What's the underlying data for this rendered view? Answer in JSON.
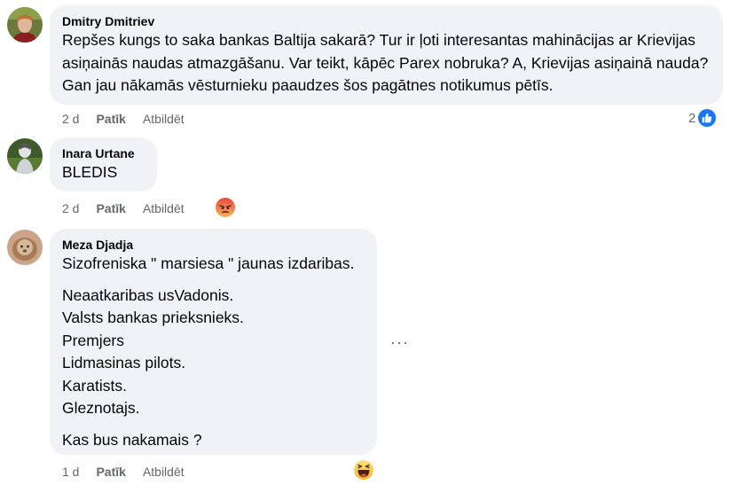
{
  "comments": [
    {
      "author": "Dmitry Dmitriev",
      "text": "Repšes kungs to saka bankas Baltija sakarā? Tur ir ļoti interesantas mahinācijas ar Krievijas asiņainās naudas atmazgāšanu. Var teikt, kāpēc Parex nobruka? A, Krievijas asiņainā nauda? Gan jau nākamās vēsturnieku paaudzes šos pagātnes notikumus pētīs.",
      "time": "2 d",
      "like_label": "Patīk",
      "reply_label": "Atbildēt",
      "reaction_count": "2",
      "reaction": "like-icon"
    },
    {
      "author": "Inara Urtane",
      "text": "BLEDIS",
      "time": "2 d",
      "like_label": "Patīk",
      "reply_label": "Atbildēt",
      "reaction": "angry-emoji-icon"
    },
    {
      "author": "Meza Djadja",
      "paragraphs": [
        "Sizofreniska \" marsiesa \" jaunas izdaribas.",
        "Neaatkaribas usVadonis.\nValsts bankas prieksnieks.\nPremjers\nLidmasinas pilots.\nKaratists.\nGleznotajs.",
        "Kas bus nakamais ?"
      ],
      "time": "1 d",
      "like_label": "Patīk",
      "reply_label": "Atbildēt",
      "more_label": "···",
      "reaction": "laughing-emoji-icon"
    }
  ],
  "colors": {
    "bubble": "#f0f2f5",
    "secondary_text": "#65676b",
    "like_blue": "#1877f2"
  }
}
